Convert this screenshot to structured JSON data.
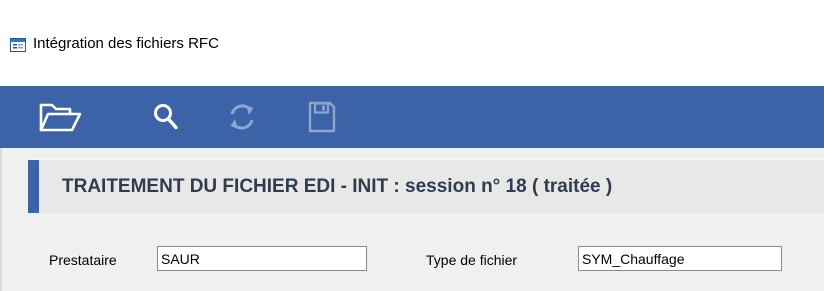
{
  "window": {
    "title": "Intégration des fichiers RFC",
    "icon": "window-form-icon"
  },
  "toolbar": {
    "buttons": [
      {
        "name": "open-folder",
        "icon": "folder-open-icon",
        "enabled": true
      },
      {
        "name": "search",
        "icon": "search-icon",
        "enabled": true
      },
      {
        "name": "refresh",
        "icon": "refresh-icon",
        "enabled": false
      },
      {
        "name": "save",
        "icon": "save-icon",
        "enabled": false
      }
    ]
  },
  "header": {
    "title": "TRAITEMENT DU FICHIER EDI - INIT : session n° 18 ( traitée )"
  },
  "form": {
    "prestataire_label": "Prestataire",
    "prestataire_value": "SAUR",
    "type_fichier_label": "Type de fichier",
    "type_fichier_value": "SYM_Chauffage"
  },
  "colors": {
    "toolbar_bg": "#3c62a7",
    "header_accent": "#3c62a7",
    "header_text": "#2f3c4f",
    "icon_enabled": "#ffffff",
    "icon_disabled": "#8fa4cf"
  }
}
